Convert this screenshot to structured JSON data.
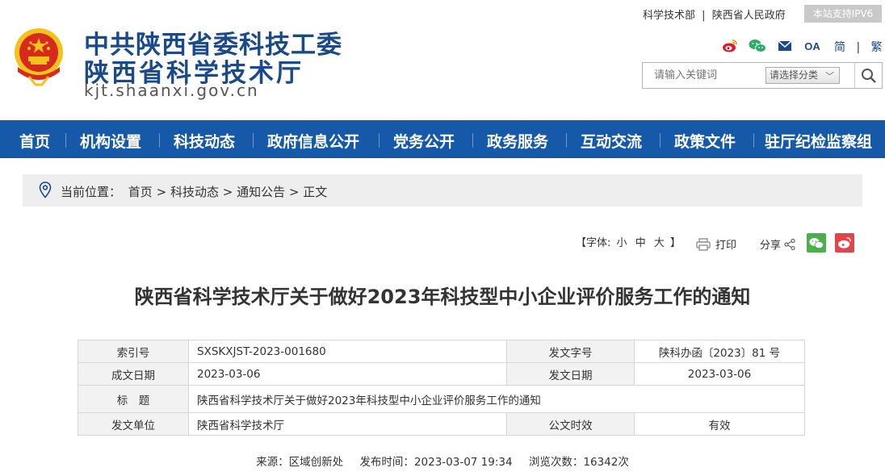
{
  "header": {
    "org_line1": "中共陕西省委科技工委",
    "org_line2": "陕西省科学技术厅",
    "domain": "kjt.shaanxi.gov.cn",
    "top_links": [
      "科学技术部",
      "陕西省人民政府"
    ],
    "top_link_sep": "|",
    "ipv6_badge": "本站支持IPV6",
    "social_icons": [
      "weibo-icon",
      "wechat-icon",
      "mail-icon",
      "oa-icon"
    ],
    "oa_label": "OA",
    "lang_simplified": "简",
    "lang_traditional": "繁",
    "lang_sep": "|",
    "search_placeholder": "请输入关键词",
    "search_category": "请选择分类"
  },
  "nav": {
    "items": [
      "首页",
      "机构设置",
      "科技动态",
      "政府信息公开",
      "党务公开",
      "政务服务",
      "互动交流",
      "政策文件",
      "驻厅纪检监察组"
    ]
  },
  "breadcrumb": {
    "label": "当前位置：",
    "items": [
      "首页",
      "科技动态",
      "通知公告",
      "正文"
    ],
    "sep": ">"
  },
  "tools": {
    "font_label_open": "【字体:",
    "font_small": "小",
    "font_medium": "中",
    "font_large": "大",
    "font_label_close": "】",
    "print": "打印",
    "share": "分享"
  },
  "article": {
    "title": "陕西省科学技术厅关于做好2023年科技型中小企业评价服务工作的通知",
    "info": {
      "index_key": "索引号",
      "index_val": "SXSKXJST-2023-001680",
      "docno_key": "发文字号",
      "docno_val": "陕科办函〔2023〕81 号",
      "created_key": "成文日期",
      "created_val": "2023-03-06",
      "issued_key": "发文日期",
      "issued_val": "2023-03-06",
      "title_key": "标　题",
      "title_val": "陕西省科学技术厅关于做好2023年科技型中小企业评价服务工作的通知",
      "unit_key": "发文单位",
      "unit_val": "陕西省科学技术厅",
      "valid_key": "公文时效",
      "valid_val": "有效"
    },
    "meta": {
      "source": "来源：区域创新处",
      "published": "发布时间：2023-03-07 19:34",
      "views": "浏览次数：16342次"
    }
  },
  "colors": {
    "brand_blue": "#1a4a8a",
    "nav_blue": "#1559a8",
    "emblem_red": "#d62a1f",
    "emblem_gold": "#f3c21b"
  }
}
